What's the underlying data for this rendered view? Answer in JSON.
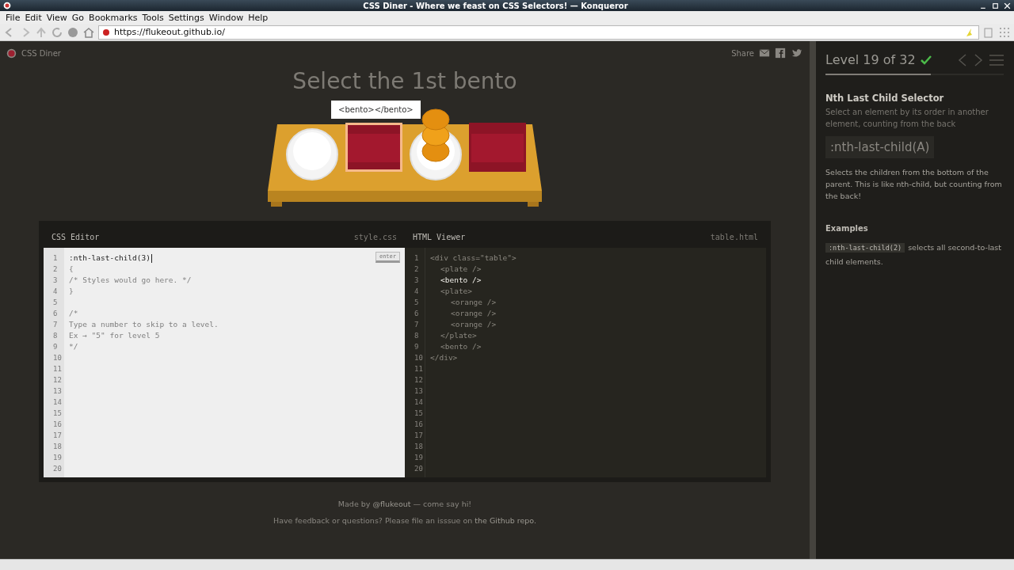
{
  "window": {
    "title": "CSS Diner - Where we feast on CSS Selectors! — Konqueror"
  },
  "menu": [
    "File",
    "Edit",
    "View",
    "Go",
    "Bookmarks",
    "Tools",
    "Settings",
    "Window",
    "Help"
  ],
  "toolbar": {
    "url": "https://flukeout.github.io/"
  },
  "header": {
    "logo": "CSS Diner",
    "share": "Share"
  },
  "instruction": "Select the 1st bento",
  "tooltip": "<bento></bento>",
  "table_items": [
    {
      "kind": "plate",
      "hovered": false
    },
    {
      "kind": "bento",
      "hovered": true
    },
    {
      "kind": "plate",
      "hovered": false,
      "children": [
        {
          "kind": "orange"
        },
        {
          "kind": "orange"
        },
        {
          "kind": "orange"
        }
      ]
    },
    {
      "kind": "bento",
      "hovered": false
    }
  ],
  "css_editor": {
    "title": "CSS Editor",
    "file": "style.css",
    "enter": "enter",
    "lines": [
      {
        "number": "1",
        "text": ":nth-last-child(3)",
        "kind": "input"
      },
      {
        "number": "2",
        "text": "{",
        "kind": "comment"
      },
      {
        "number": "3",
        "text": "/* Styles would go here. */",
        "kind": "comment"
      },
      {
        "number": "4",
        "text": "}",
        "kind": "comment"
      },
      {
        "number": "5"
      },
      {
        "number": "6",
        "text": "/*",
        "kind": "comment"
      },
      {
        "number": "7",
        "text": "Type a number to skip to a level.",
        "kind": "comment"
      },
      {
        "number": "8",
        "text": "Ex → \"5\" for level 5",
        "kind": "comment"
      },
      {
        "number": "9",
        "text": "*/",
        "kind": "comment"
      },
      {
        "number": "10"
      },
      {
        "number": "11"
      },
      {
        "number": "12"
      },
      {
        "number": "13"
      },
      {
        "number": "14"
      },
      {
        "number": "15"
      },
      {
        "number": "16"
      },
      {
        "number": "17"
      },
      {
        "number": "18"
      },
      {
        "number": "19"
      },
      {
        "number": "20"
      }
    ]
  },
  "html_viewer": {
    "title": "HTML Viewer",
    "file": "table.html",
    "tree": [
      {
        "number": "1",
        "text": "<div class=\"table\">",
        "highlighted": false,
        "children": [
          {
            "number": "2",
            "text": "<plate />",
            "highlighted": false
          },
          {
            "number": "3",
            "text": "<bento />",
            "highlighted": true
          },
          {
            "number": "4",
            "text": "<plate>",
            "highlighted": false,
            "children": [
              {
                "number": "5",
                "text": "<orange />",
                "highlighted": false
              },
              {
                "number": "6",
                "text": "<orange />",
                "highlighted": false
              },
              {
                "number": "7",
                "text": "<orange />",
                "highlighted": false
              }
            ],
            "closing": {
              "number": "8",
              "text": "</plate>"
            }
          },
          {
            "number": "9",
            "text": "<bento />",
            "highlighted": false
          }
        ],
        "closing": {
          "number": "10",
          "text": "</div>"
        }
      }
    ],
    "blank_lines": [
      "11",
      "12",
      "13",
      "14",
      "15",
      "16",
      "17",
      "18",
      "19",
      "20"
    ]
  },
  "footer": {
    "credit_before": "Made by",
    "credit_link": "@flukeout",
    "credit_after": "— come say hi!",
    "feedback": "Have feedback or questions? Please file an isssue on",
    "feedback_link": "the Github repo."
  },
  "sidebar": {
    "level": "Level 19 of 32",
    "completed": true,
    "progress": {
      "level": 0.59
    },
    "selector_name": "Nth Last Child Selector",
    "title": "Select an element by its order in another element, counting from the back",
    "syntax": ":nth-last-child(A)",
    "description": "Selects the children from the bottom of the parent. This is like nth-child, but counting from the back!",
    "examples_heading": "Examples",
    "examples": [
      {
        "code": ":nth-last-child(2)",
        "text": "selects all second-to-last child elements."
      }
    ]
  }
}
